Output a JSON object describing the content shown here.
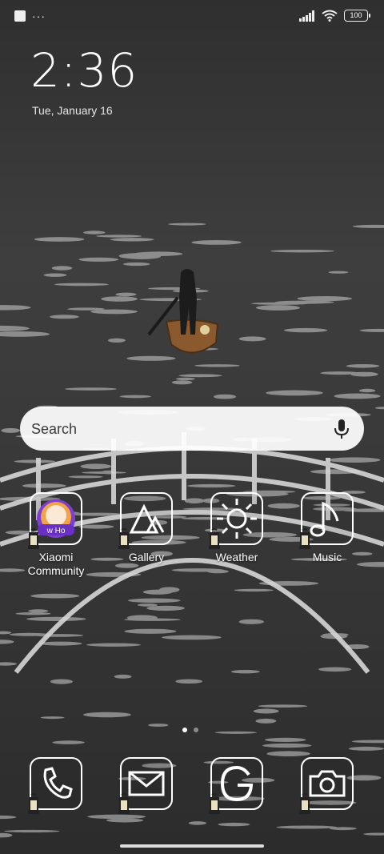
{
  "status_bar": {
    "battery": "100",
    "more_dots": "···"
  },
  "lock": {
    "time": "2:36",
    "date": "Tue, January 16"
  },
  "search": {
    "placeholder": "Search"
  },
  "apps": [
    {
      "label": "Xiaomi Community",
      "icon": "xiaomi-community-icon",
      "badge_text": "w Ho"
    },
    {
      "label": "Gallery",
      "icon": "gallery-icon"
    },
    {
      "label": "Weather",
      "icon": "weather-icon"
    },
    {
      "label": "Music",
      "icon": "music-icon"
    }
  ],
  "dock": [
    {
      "name": "phone",
      "icon": "phone-icon"
    },
    {
      "name": "messages",
      "icon": "mail-icon"
    },
    {
      "name": "browser",
      "icon": "browser-icon"
    },
    {
      "name": "camera",
      "icon": "camera-icon"
    }
  ],
  "page_indicator": {
    "pages": 2,
    "current": 1
  },
  "colors": {
    "background": "#3a3a3a",
    "water_highlight": "#d8d8d8",
    "boat": "#8a5a2e"
  }
}
